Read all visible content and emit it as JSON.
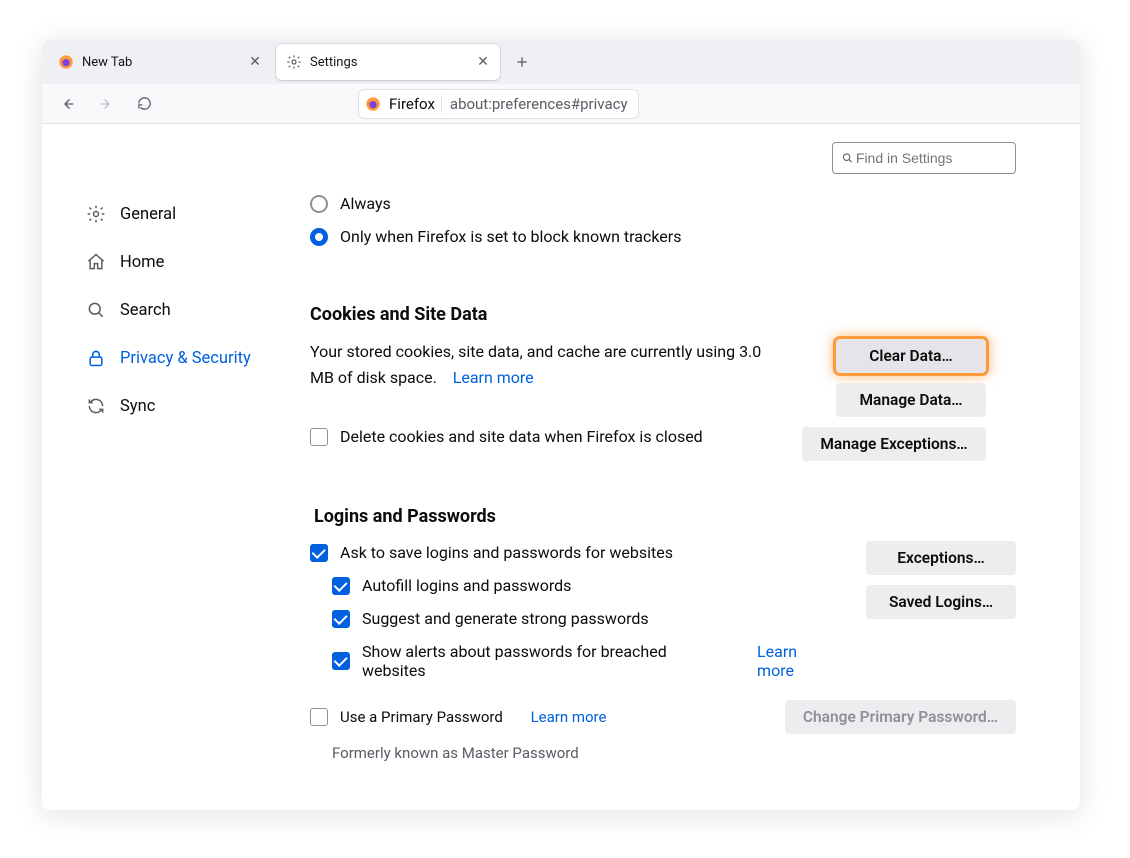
{
  "tabs": {
    "newtab_label": "New Tab",
    "settings_label": "Settings"
  },
  "toolbar": {
    "product": "Firefox",
    "address": "about:preferences#privacy"
  },
  "search": {
    "placeholder": "Find in Settings"
  },
  "sidebar": {
    "items": [
      {
        "label": "General"
      },
      {
        "label": "Home"
      },
      {
        "label": "Search"
      },
      {
        "label": "Privacy & Security"
      },
      {
        "label": "Sync"
      }
    ]
  },
  "trackers": {
    "always_label": "Always",
    "only_label": "Only when Firefox is set to block known trackers"
  },
  "cookies": {
    "heading": "Cookies and Site Data",
    "desc": "Your stored cookies, site data, and cache are currently using 3.0 MB of disk space.",
    "learn_more": "Learn more",
    "delete_label": "Delete cookies and site data when Firefox is closed",
    "clear_btn": "Clear Data…",
    "manage_btn": "Manage Data…",
    "exceptions_btn": "Manage Exceptions…"
  },
  "logins": {
    "heading": "Logins and Passwords",
    "ask_label": "Ask to save logins and passwords for websites",
    "autofill_label": "Autofill logins and passwords",
    "suggest_label": "Suggest and generate strong passwords",
    "alerts_label": "Show alerts about passwords for breached websites",
    "alerts_learn_more": "Learn more",
    "primary_label": "Use a Primary Password",
    "primary_learn_more": "Learn more",
    "primary_hint": "Formerly known as Master Password",
    "exceptions_btn": "Exceptions…",
    "saved_btn": "Saved Logins…",
    "change_primary_btn": "Change Primary Password…"
  }
}
